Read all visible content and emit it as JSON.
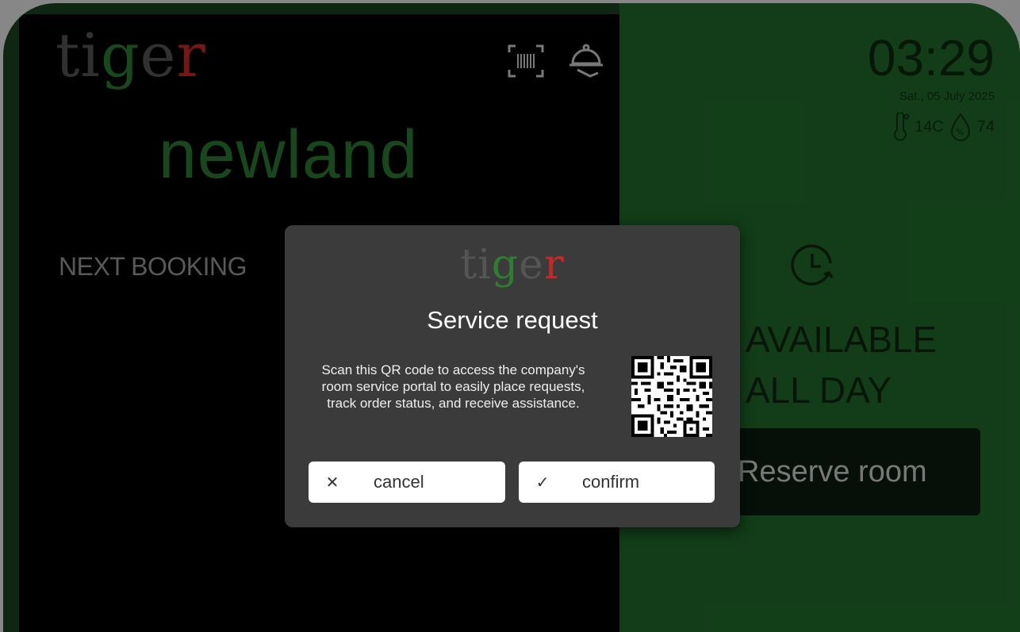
{
  "brand": {
    "logo_letters": [
      "t",
      "i",
      "g",
      "e",
      "r"
    ]
  },
  "room": {
    "name": "newland"
  },
  "header": {
    "scan_icon": "barcode-scan-icon",
    "service_icon": "room-service-bell-icon"
  },
  "status": {
    "time": "03:29",
    "date": "Sat., 05 July 2025",
    "temperature": "14C",
    "humidity": "74"
  },
  "booking": {
    "next_label": "NEXT BOOKING"
  },
  "availability": {
    "line1": "AVAILABLE",
    "line2": "ALL DAY",
    "reserve_label": "Reserve room"
  },
  "modal": {
    "title": "Service request",
    "description": "Scan this QR code to access the company's room service portal to easily place requests, track order status, and receive assistance.",
    "cancel_label": "cancel",
    "confirm_label": "confirm"
  },
  "colors": {
    "left_panel": "#000000",
    "right_panel": "#1f6a2a",
    "brand_green": "#2e7d32",
    "brand_red": "#c62828"
  }
}
